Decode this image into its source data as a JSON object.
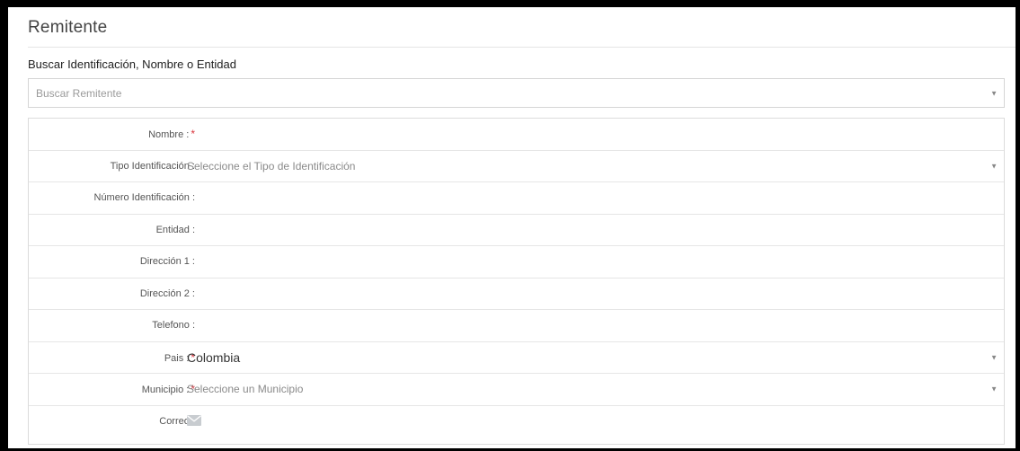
{
  "section": {
    "title": "Remitente"
  },
  "search": {
    "label": "Buscar Identificación, Nombre o Entidad",
    "placeholder": "Buscar Remitente"
  },
  "form": {
    "rows": [
      {
        "label": "Nombre :",
        "required": true,
        "kind": "input",
        "value": ""
      },
      {
        "label": "Tipo Identificación :",
        "required": false,
        "kind": "select",
        "placeholder": "Seleccione el Tipo de Identificación"
      },
      {
        "label": "Número Identificación :",
        "required": false,
        "kind": "input",
        "value": ""
      },
      {
        "label": "Entidad :",
        "required": false,
        "kind": "input",
        "value": ""
      },
      {
        "label": "Dirección 1 :",
        "required": false,
        "kind": "input",
        "value": ""
      },
      {
        "label": "Dirección 2 :",
        "required": false,
        "kind": "input",
        "value": ""
      },
      {
        "label": "Telefono :",
        "required": false,
        "kind": "input",
        "value": ""
      },
      {
        "label": "Pais :",
        "required": true,
        "kind": "select",
        "value": "Colombia"
      },
      {
        "label": "Municipio :",
        "required": true,
        "kind": "select",
        "placeholder": "Seleccione un Municipio"
      },
      {
        "label": "Correo :",
        "required": false,
        "kind": "email",
        "icon": "envelope-icon"
      }
    ],
    "required_marker": "*"
  },
  "colors": {
    "required": "#d9363e",
    "border": "#dcdcdc",
    "label": "#555555",
    "placeholder": "#8a8a8a"
  }
}
